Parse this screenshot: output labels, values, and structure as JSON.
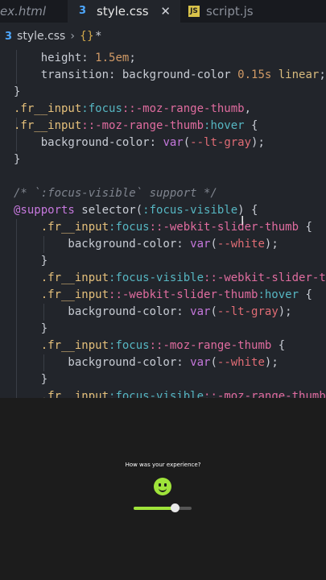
{
  "tabs": [
    {
      "label": "ex.html",
      "active": false
    },
    {
      "label": "style.css",
      "active": true,
      "icon": "css-icon"
    },
    {
      "label": "script.js",
      "active": false,
      "icon": "js-icon"
    }
  ],
  "breadcrumb": {
    "file": "style.css",
    "symbol": "*"
  },
  "code_lines": [
    "    height: 1.5em;",
    "    transition: background-color 0.15s linear;",
    "}",
    ".fr__input:focus::-moz-range-thumb,",
    ".fr__input::-moz-range-thumb:hover {",
    "    background-color: var(--lt-gray);",
    "}",
    "",
    "/* `:focus-visible` support */",
    "@supports selector(:focus-visible) {",
    "    .fr__input:focus::-webkit-slider-thumb {",
    "        background-color: var(--white);",
    "    }",
    "    .fr__input:focus-visible::-webkit-slider-thumb,",
    "    .fr__input::-webkit-slider-thumb:hover {",
    "        background-color: var(--lt-gray);",
    "    }",
    "    .fr__input:focus::-moz-range-thumb {",
    "        background-color: var(--white);",
    "    }",
    "    .fr__input:focus-visible::-moz-range-thumb,"
  ],
  "preview": {
    "question": "How was your experience?",
    "rating_fraction": 0.71,
    "colors": {
      "accent": "#9fe33a",
      "track": "#555555",
      "thumb": "#e9e9e9"
    }
  }
}
